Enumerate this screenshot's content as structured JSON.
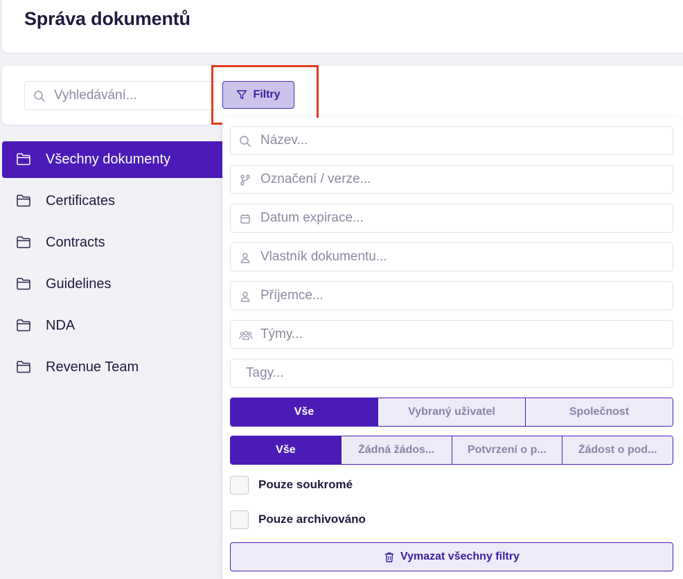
{
  "header": {
    "title": "Správa dokumentů"
  },
  "toolbar": {
    "search_placeholder": "Vyhledávání...",
    "filter_label": "Filtry"
  },
  "sidebar": {
    "items": [
      {
        "label": "Všechny dokumenty",
        "active": true
      },
      {
        "label": "Certificates"
      },
      {
        "label": "Contracts"
      },
      {
        "label": "Guidelines"
      },
      {
        "label": "NDA"
      },
      {
        "label": "Revenue Team"
      }
    ]
  },
  "filters": {
    "fields": [
      {
        "placeholder": "Název...",
        "icon": "search-icon"
      },
      {
        "placeholder": "Označení / verze...",
        "icon": "branch-icon"
      },
      {
        "placeholder": "Datum expirace...",
        "icon": "calendar-icon"
      },
      {
        "placeholder": "Vlastník dokumentu...",
        "icon": "user-icon"
      },
      {
        "placeholder": "Příjemce...",
        "icon": "user-icon"
      },
      {
        "placeholder": "Týmy...",
        "icon": "users-icon"
      },
      {
        "placeholder": "Tagy..."
      }
    ],
    "scope_options": [
      "Vše",
      "Vybraný uživatel",
      "Společnost"
    ],
    "request_options": [
      "Vše",
      "Žádná žádos...",
      "Potvrzení o p...",
      "Žádost o pod..."
    ],
    "checkboxes": [
      "Pouze soukromé",
      "Pouze archivováno"
    ],
    "clear_label": "Vymazat všechny filtry"
  },
  "colors": {
    "accent": "#4b1bb8",
    "accent_light": "#eeebf8",
    "highlight": "#e23b1e"
  }
}
